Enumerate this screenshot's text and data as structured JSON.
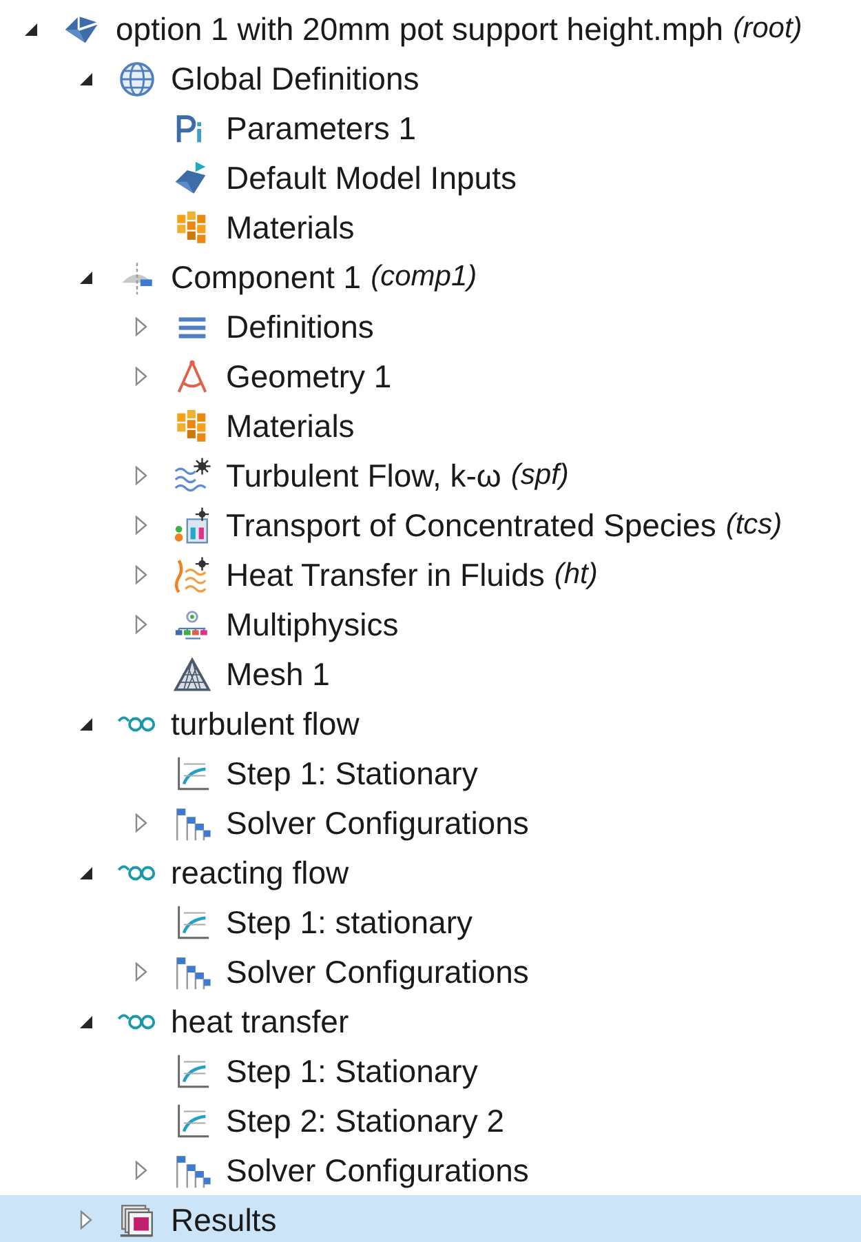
{
  "tree": [
    {
      "label": "option 1 with 20mm pot support height.mph",
      "suffix": "(root)",
      "kind": "model",
      "expanded": true,
      "selected": false,
      "children": [
        {
          "label": "Global Definitions",
          "kind": "globe",
          "expanded": true,
          "selected": false,
          "children": [
            {
              "label": "Parameters 1",
              "kind": "parameters",
              "selected": false
            },
            {
              "label": "Default Model Inputs",
              "kind": "model-inputs",
              "selected": false
            },
            {
              "label": "Materials",
              "kind": "materials",
              "selected": false
            }
          ]
        },
        {
          "label": "Component 1",
          "suffix": "(comp1)",
          "kind": "component",
          "expanded": true,
          "selected": false,
          "children": [
            {
              "label": "Definitions",
              "kind": "definitions",
              "expanded": false,
              "selected": false
            },
            {
              "label": "Geometry 1",
              "kind": "geometry",
              "expanded": false,
              "selected": false
            },
            {
              "label": "Materials",
              "kind": "materials",
              "selected": false
            },
            {
              "label": "Turbulent Flow, k-ω",
              "suffix": "(spf)",
              "kind": "turbulent-flow",
              "expanded": false,
              "selected": false
            },
            {
              "label": "Transport of Concentrated Species",
              "suffix": "(tcs)",
              "kind": "species",
              "expanded": false,
              "selected": false
            },
            {
              "label": "Heat Transfer in Fluids",
              "suffix": "(ht)",
              "kind": "heat",
              "expanded": false,
              "selected": false
            },
            {
              "label": "Multiphysics",
              "kind": "multiphysics",
              "expanded": false,
              "selected": false
            },
            {
              "label": "Mesh 1",
              "kind": "mesh",
              "selected": false
            }
          ]
        },
        {
          "label": "turbulent flow",
          "kind": "study",
          "expanded": true,
          "selected": false,
          "children": [
            {
              "label": "Step 1: Stationary",
              "kind": "study-step",
              "selected": false
            },
            {
              "label": "Solver Configurations",
              "kind": "solver",
              "expanded": false,
              "selected": false
            }
          ]
        },
        {
          "label": "reacting flow",
          "kind": "study",
          "expanded": true,
          "selected": false,
          "children": [
            {
              "label": "Step 1: stationary",
              "kind": "study-step",
              "selected": false
            },
            {
              "label": "Solver Configurations",
              "kind": "solver",
              "expanded": false,
              "selected": false
            }
          ]
        },
        {
          "label": "heat transfer",
          "kind": "study",
          "expanded": true,
          "selected": false,
          "children": [
            {
              "label": "Step 1: Stationary",
              "kind": "study-step",
              "selected": false
            },
            {
              "label": "Step 2: Stationary 2",
              "kind": "study-step",
              "selected": false
            },
            {
              "label": "Solver Configurations",
              "kind": "solver",
              "expanded": false,
              "selected": false
            }
          ]
        },
        {
          "label": "Results",
          "kind": "results",
          "expanded": false,
          "selected": true
        }
      ]
    }
  ]
}
